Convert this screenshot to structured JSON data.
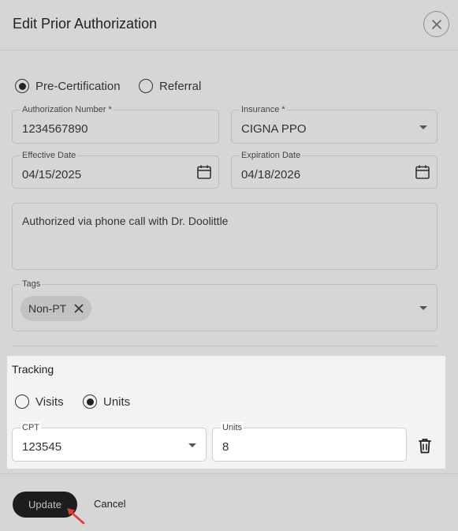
{
  "dialog": {
    "title": "Edit Prior Authorization"
  },
  "auth_type": {
    "options": [
      {
        "label": "Pre-Certification",
        "selected": true
      },
      {
        "label": "Referral",
        "selected": false
      }
    ]
  },
  "fields": {
    "authorization_number": {
      "label": "Authorization Number *",
      "value": "1234567890"
    },
    "insurance": {
      "label": "Insurance *",
      "value": "CIGNA PPO"
    },
    "effective_date": {
      "label": "Effective Date",
      "value": "04/15/2025"
    },
    "expiration_date": {
      "label": "Expiration Date",
      "value": "04/18/2026"
    },
    "notes": {
      "value": "Authorized via phone call with Dr. Doolittle"
    },
    "tags": {
      "label": "Tags",
      "chips": [
        "Non-PT"
      ]
    }
  },
  "tracking": {
    "title": "Tracking",
    "options": [
      {
        "label": "Visits",
        "selected": false
      },
      {
        "label": "Units",
        "selected": true
      }
    ],
    "cpt": {
      "label": "CPT",
      "value": "123545"
    },
    "units": {
      "label": "Units",
      "value": "8"
    }
  },
  "footer": {
    "update_label": "Update",
    "cancel_label": "Cancel"
  },
  "colors": {
    "overlay": "#d6d6d6",
    "primary_button": "#1d1d1d",
    "cursor": "#e53935"
  }
}
